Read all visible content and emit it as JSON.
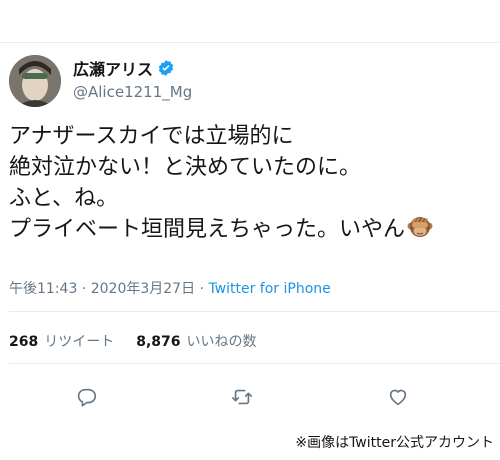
{
  "tweet": {
    "display_name": "広瀬アリス",
    "handle": "@Alice1211_Mg",
    "verified_icon": "verified-badge-icon",
    "text_lines": [
      "アナザースカイでは立場的に",
      "絶対泣かない！と決めていたのに。",
      "ふと、ね。",
      "プライベート垣間見えちゃった。いやん"
    ],
    "emoji": "see-no-evil-monkey-icon",
    "time": "午後11:43",
    "separator": "·",
    "date": "2020年3月27日",
    "source": "Twitter for iPhone"
  },
  "stats": {
    "retweets_count": "268",
    "retweets_label": "リツイート",
    "likes_count": "8,876",
    "likes_label": "いいねの数"
  },
  "actions": {
    "reply_icon": "reply-icon",
    "retweet_icon": "retweet-icon",
    "like_icon": "heart-icon"
  },
  "caption": "※画像はTwitter公式アカウント",
  "colors": {
    "text": "#14171a",
    "secondary": "#657786",
    "link": "#1b95e0",
    "verified": "#1da1f2",
    "divider": "#e6ecf0"
  }
}
